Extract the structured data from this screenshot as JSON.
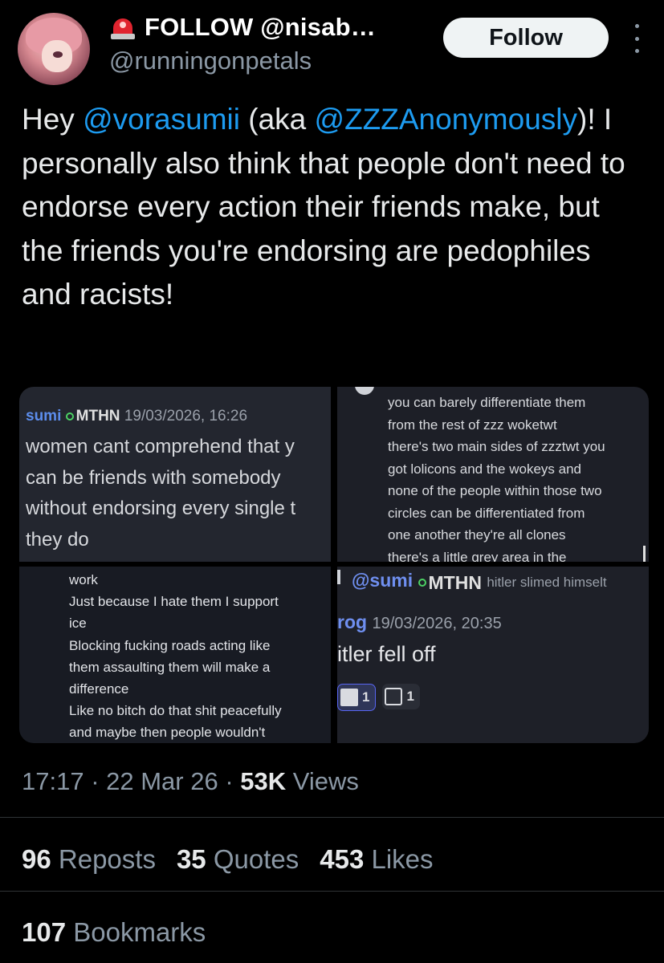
{
  "author": {
    "display_name": "FOLLOW @nisab…",
    "handle": "@runningonpetals",
    "avatar_icon": "profile-picture",
    "badge_icon": "siren-emoji"
  },
  "follow_button": {
    "label": "Follow"
  },
  "tweet": {
    "text_before": "Hey ",
    "mention1": "@vorasumii",
    "text_mid": " (aka ",
    "mention2": "@ZZZAnonymously",
    "text_after": ")! I personally also think that people don't need to endorse every action their friends make, but the friends you're endorsing are pedophiles and racists!"
  },
  "media": {
    "image1": {
      "username": "sumi",
      "tag": "MTHN",
      "timestamp": "19/03/2026, 16:26",
      "lines": [
        "women cant comprehend that y",
        "can be friends with somebody",
        "without endorsing every single t",
        "they do"
      ]
    },
    "image2": {
      "lines": [
        "you can barely differentiate them",
        "from the rest of zzz woketwt",
        "there's two main sides of zzztwt you",
        "got lolicons and the wokeys and",
        "none of the people within those two",
        "circles can be differentiated from",
        "one another they're all clones",
        "there's a little grey area in the"
      ]
    },
    "image3": {
      "lines": [
        "work",
        "Just because I hate them I support",
        "ice",
        "Blocking fucking roads acting like",
        "them assaulting them will make a",
        "difference",
        "Like no bitch do that shit peacefully",
        "and maybe then people wouldn't"
      ]
    },
    "image4": {
      "reply_user": "@sumi",
      "reply_tag": "MTHN",
      "reply_preview": "hitler slimed himselt",
      "username": "rog",
      "timestamp": "19/03/2026, 20:35",
      "message": "itler fell off",
      "reactions": [
        {
          "count": "1",
          "icon": "emoji-reaction-icon"
        },
        {
          "count": "1",
          "icon": "emoji-reaction-icon"
        }
      ]
    }
  },
  "meta": {
    "time": "17:17",
    "date": "22 Mar 26",
    "views_count": "53K",
    "views_label": "Views"
  },
  "stats": {
    "reposts_count": "96",
    "reposts_label": "Reposts",
    "quotes_count": "35",
    "quotes_label": "Quotes",
    "likes_count": "453",
    "likes_label": "Likes",
    "bookmarks_count": "107",
    "bookmarks_label": "Bookmarks"
  },
  "colors": {
    "background": "#000000",
    "text": "#e7e9ea",
    "muted": "#8b98a5",
    "link": "#1d9bf0",
    "follow_bg": "#eff3f4"
  }
}
